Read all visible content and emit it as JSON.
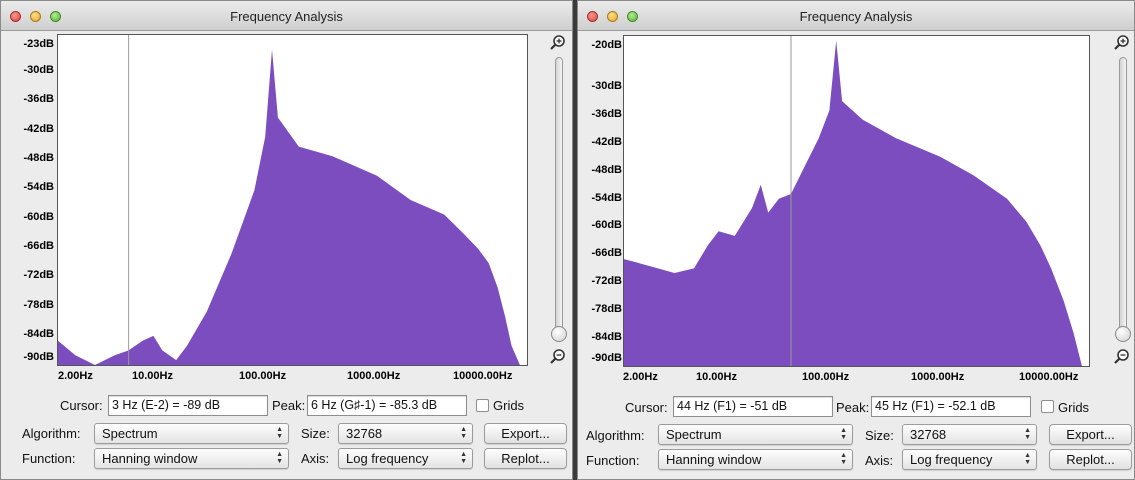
{
  "accent_color": "#7b4dbf",
  "windows": [
    {
      "title": "Frequency Analysis",
      "y_ticks": [
        "-23dB",
        "-30dB",
        "-36dB",
        "-42dB",
        "-48dB",
        "-54dB",
        "-60dB",
        "-66dB",
        "-72dB",
        "-78dB",
        "-84dB",
        "-90dB"
      ],
      "x_ticks": [
        "2.00Hz",
        "10.00Hz",
        "100.00Hz",
        "1000.00Hz",
        "10000.00Hz"
      ],
      "cursor_label": "Cursor:",
      "cursor_value": "3 Hz (E-2) = -89 dB",
      "peak_label": "Peak:",
      "peak_value": "6 Hz (G♯-1) = -85.3 dB",
      "grids_label": "Grids",
      "algorithm_label": "Algorithm:",
      "algorithm_value": "Spectrum",
      "size_label": "Size:",
      "size_value": "32768",
      "function_label": "Function:",
      "function_value": "Hanning window",
      "axis_label": "Axis:",
      "axis_value": "Log frequency",
      "export_label": "Export...",
      "replot_label": "Replot..."
    },
    {
      "title": "Frequency Analysis",
      "y_ticks": [
        "-20dB",
        "-30dB",
        "-36dB",
        "-42dB",
        "-48dB",
        "-54dB",
        "-60dB",
        "-66dB",
        "-72dB",
        "-78dB",
        "-84dB",
        "-90dB"
      ],
      "x_ticks": [
        "2.00Hz",
        "10.00Hz",
        "100.00Hz",
        "1000.00Hz",
        "10000.00Hz"
      ],
      "cursor_label": "Cursor:",
      "cursor_value": "44 Hz (F1) = -51 dB",
      "peak_label": "Peak:",
      "peak_value": "45 Hz (F1) = -52.1 dB",
      "grids_label": "Grids",
      "algorithm_label": "Algorithm:",
      "algorithm_value": "Spectrum",
      "size_label": "Size:",
      "size_value": "32768",
      "function_label": "Function:",
      "function_value": "Hanning window",
      "axis_label": "Axis:",
      "axis_value": "Log frequency",
      "export_label": "Export...",
      "replot_label": "Replot..."
    }
  ],
  "chart_data": [
    {
      "type": "area",
      "x_scale": "log",
      "xlim": [
        1.4,
        22000
      ],
      "ylim": [
        -91,
        -23
      ],
      "cursor_x": 6,
      "x": [
        1.4,
        2,
        3,
        4.5,
        6,
        8,
        10,
        12,
        16,
        20,
        30,
        50,
        80,
        100,
        115,
        130,
        200,
        400,
        1000,
        2000,
        4000,
        6000,
        8000,
        10000,
        12000,
        14000,
        16000,
        19000
      ],
      "values": [
        -86,
        -89,
        -91,
        -89,
        -88,
        -86,
        -85,
        -88,
        -90,
        -87,
        -80,
        -68,
        -55,
        -44,
        -26,
        -40,
        -46,
        -48,
        -52,
        -57,
        -60,
        -64,
        -67,
        -70,
        -75,
        -81,
        -87,
        -91
      ]
    },
    {
      "type": "area",
      "x_scale": "log",
      "xlim": [
        1.4,
        22000
      ],
      "ylim": [
        -91,
        -20
      ],
      "cursor_x": 45,
      "x": [
        1.4,
        2,
        4,
        6,
        8,
        10,
        14,
        20,
        24,
        28,
        35,
        45,
        60,
        80,
        100,
        115,
        130,
        200,
        400,
        1000,
        2000,
        4000,
        6000,
        8000,
        10000,
        13000,
        16000,
        19000
      ],
      "values": [
        -68,
        -69,
        -71,
        -70,
        -65,
        -62,
        -63,
        -57,
        -52,
        -58,
        -55,
        -54,
        -48,
        -42,
        -36,
        -21,
        -34,
        -38,
        -42,
        -46,
        -50,
        -55,
        -60,
        -65,
        -70,
        -77,
        -84,
        -91
      ]
    }
  ]
}
